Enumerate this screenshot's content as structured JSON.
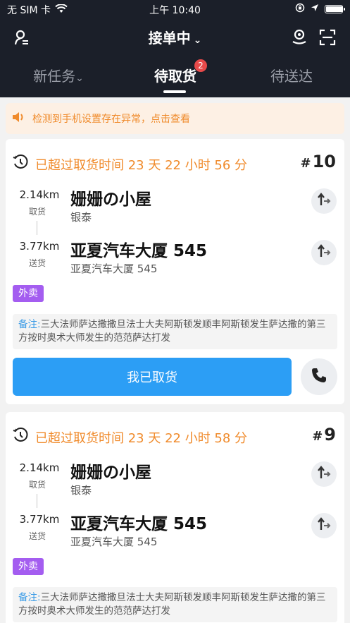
{
  "status_bar": {
    "carrier": "无 SIM 卡",
    "time": "上午 10:40"
  },
  "header": {
    "title": "接单中"
  },
  "tabs": [
    {
      "label": "新任务",
      "has_chevron": true
    },
    {
      "label": "待取货",
      "badge": "2"
    },
    {
      "label": "待送达"
    }
  ],
  "notice": {
    "text": "检测到手机设置存在异常，点击查看"
  },
  "orders": [
    {
      "overdue_text": "已超过取货时间 23 天 22 小时 56 分",
      "number": "10",
      "pickup": {
        "distance": "2.14km",
        "kind": "取货",
        "name": "姗姗の小屋",
        "sub": "银泰"
      },
      "delivery": {
        "distance": "3.77km",
        "kind": "送货",
        "name": "亚夏汽车大厦 545",
        "sub": "亚夏汽车大厦 545"
      },
      "tag": "外卖",
      "remark_label": "备注:",
      "remark_text": "三大法师萨达撒撒旦法士大夫阿斯顿发顺丰阿斯顿发生萨达撒的第三方按时奥术大师发生的范范萨达打发",
      "action_label": "我已取货"
    },
    {
      "overdue_text": "已超过取货时间 23 天 22 小时 58 分",
      "number": "9",
      "pickup": {
        "distance": "2.14km",
        "kind": "取货",
        "name": "姗姗の小屋",
        "sub": "银泰"
      },
      "delivery": {
        "distance": "3.77km",
        "kind": "送货",
        "name": "亚夏汽车大厦 545",
        "sub": "亚夏汽车大厦 545"
      },
      "tag": "外卖",
      "remark_label": "备注:",
      "remark_text": "三大法师萨达撒撒旦法士大夫阿斯顿发顺丰阿斯顿发生萨达撒的第三方按时奥术大师发生的范范萨达打发"
    }
  ],
  "colors": {
    "header_bg": "#1b1f29",
    "accent_orange": "#f08b2c",
    "primary_blue": "#2c9ef5",
    "tag_purple": "#a45df0",
    "badge_red": "#e84a4a"
  }
}
